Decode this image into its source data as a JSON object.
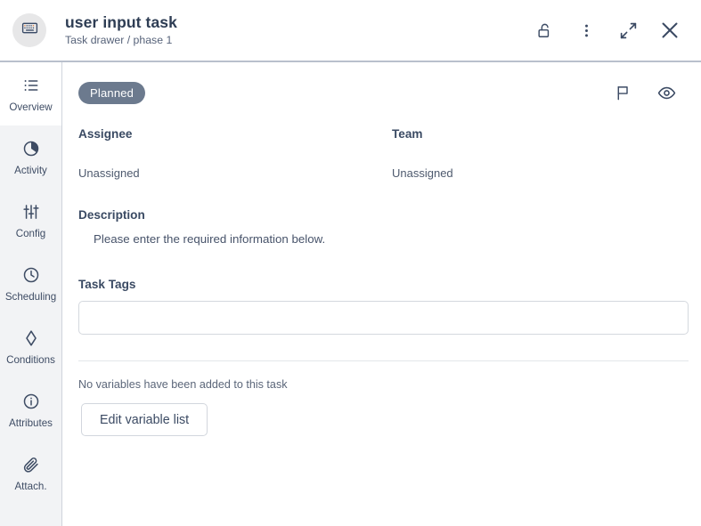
{
  "header": {
    "avatar_icon": "keyboard-icon",
    "title": "user input task",
    "subtitle": "Task drawer / phase 1",
    "actions": [
      {
        "name": "unlock-icon",
        "label": "Unlock"
      },
      {
        "name": "more-vertical-icon",
        "label": "More options"
      },
      {
        "name": "expand-icon",
        "label": "Expand"
      },
      {
        "name": "close-icon",
        "label": "Close"
      }
    ]
  },
  "sidebar": {
    "items": [
      {
        "label": "Overview",
        "icon": "list-icon",
        "active": true
      },
      {
        "label": "Activity",
        "icon": "pie-chart-icon",
        "active": false
      },
      {
        "label": "Config",
        "icon": "sliders-icon",
        "active": false
      },
      {
        "label": "Scheduling",
        "icon": "clock-icon",
        "active": false
      },
      {
        "label": "Conditions",
        "icon": "diamond-icon",
        "active": false
      },
      {
        "label": "Attributes",
        "icon": "info-icon",
        "active": false
      },
      {
        "label": "Attach.",
        "icon": "paperclip-icon",
        "active": false
      }
    ]
  },
  "main": {
    "status": {
      "badge_label": "Planned",
      "badge_color": "#6c7a8e",
      "icons": [
        {
          "name": "flag-icon",
          "label": "Flag"
        },
        {
          "name": "eye-icon",
          "label": "Watch"
        }
      ]
    },
    "assignee": {
      "label": "Assignee",
      "value": "Unassigned"
    },
    "team": {
      "label": "Team",
      "value": "Unassigned"
    },
    "description": {
      "label": "Description",
      "text": "Please enter the required information below."
    },
    "task_tags": {
      "label": "Task Tags",
      "value": "",
      "placeholder": ""
    },
    "variables": {
      "empty_message": "No variables have been added to this task",
      "edit_button_label": "Edit variable list"
    }
  }
}
